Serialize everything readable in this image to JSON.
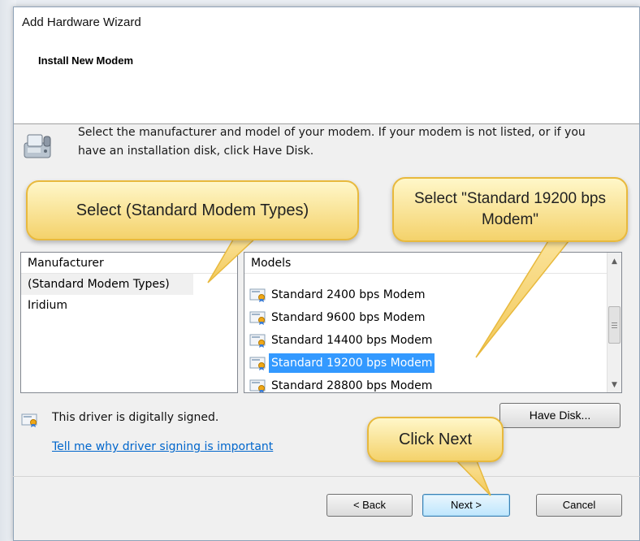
{
  "window": {
    "title": "Add Hardware Wizard"
  },
  "header": {
    "title": "Install New Modem"
  },
  "instructions": "Select the manufacturer and model of your modem. If your modem is not listed, or if you have an installation disk, click Have Disk.",
  "manufacturer_list": {
    "header": "Manufacturer",
    "items": [
      "(Standard Modem Types)",
      "Iridium"
    ],
    "selected": "(Standard Modem Types)"
  },
  "models_list": {
    "header": "Models",
    "items": [
      "Standard  2400 bps Modem",
      "Standard  9600 bps Modem",
      "Standard 14400 bps Modem",
      "Standard 19200 bps Modem",
      "Standard 28800 bps Modem"
    ],
    "selected": "Standard 19200 bps Modem"
  },
  "signing": {
    "status": "This driver is digitally signed.",
    "link": "Tell me why driver signing is important"
  },
  "buttons": {
    "have_disk": "Have Disk...",
    "back": "< Back",
    "next": "Next >",
    "cancel": "Cancel"
  },
  "callouts": {
    "manufacturer": "Select (Standard Modem Types)",
    "model": "Select \"Standard 19200 bps Modem\"",
    "next": "Click Next"
  },
  "colors": {
    "selection": "#3399ff",
    "callout_fill": "#f4d26b",
    "link": "#0066cc"
  }
}
